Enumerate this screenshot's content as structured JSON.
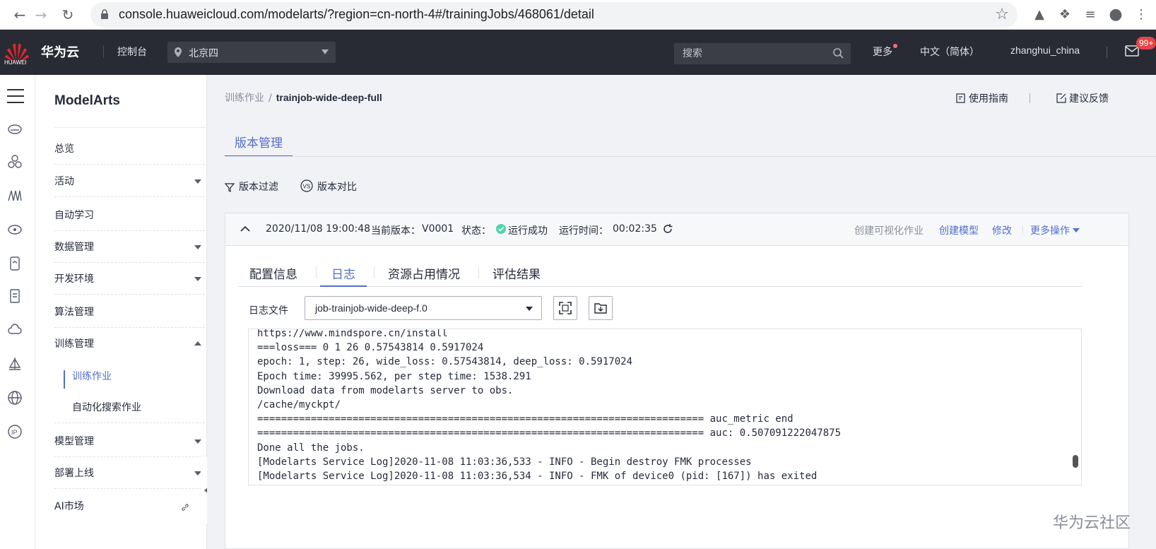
{
  "browser": {
    "url": "console.huaweicloud.com/modelarts/?region=cn-north-4#/trainingJobs/468061/detail",
    "icons": [
      "back-arrow-icon",
      "forward-arrow-icon",
      "reload-icon",
      "lock-icon",
      "star-icon",
      "drive-icon",
      "extensions-icon",
      "reading-list-icon",
      "account-icon",
      "more-vert-icon"
    ]
  },
  "topbar": {
    "logo_text": "HUAWEI",
    "brand": "华为云",
    "console": "控制台",
    "region": "北京四",
    "search_placeholder": "搜索",
    "more": "更多",
    "language": "中文（简体）",
    "username": "zhanghui_china",
    "mail_badge": "99+"
  },
  "sidebar": {
    "title": "ModelArts",
    "items": [
      {
        "label": "总览"
      },
      {
        "label": "活动"
      },
      {
        "label": "自动学习"
      },
      {
        "label": "数据管理"
      },
      {
        "label": "开发环境"
      },
      {
        "label": "算法管理"
      },
      {
        "label": "训练管理"
      },
      {
        "label": "模型管理"
      },
      {
        "label": "部署上线"
      },
      {
        "label": "AI市场"
      }
    ],
    "subitems": [
      {
        "label": "训练作业",
        "active": true
      },
      {
        "label": "自动化搜索作业",
        "active": false
      }
    ]
  },
  "breadcrumb": {
    "parent": "训练作业",
    "separator": "/",
    "current": "trainjob-wide-deep-full"
  },
  "header_links": {
    "guide": "使用指南",
    "feedback": "建议反馈"
  },
  "main_tab": "版本管理",
  "toolbar": {
    "filter": "版本过滤",
    "compare": "版本对比"
  },
  "version": {
    "datetime": "2020/11/08 19:00:48",
    "current_version_label": "当前版本：",
    "current_version": "V0001",
    "status_label": "状态：",
    "status": "运行成功",
    "runtime_label": "运行时间：",
    "runtime": "00:02:35",
    "actions": {
      "create_visual": "创建可视化作业",
      "create_model": "创建模型",
      "edit": "修改",
      "more": "更多操作"
    }
  },
  "inner_tabs": [
    "配置信息",
    "日志",
    "资源占用情况",
    "评估结果"
  ],
  "log": {
    "file_label": "日志文件",
    "file_selected": "job-trainjob-wide-deep-f.0",
    "lines": [
      "https://www.mindspore.cn/install",
      "===loss=== 0 1 26 0.57543814 0.5917024",
      "epoch: 1, step: 26, wide_loss: 0.57543814, deep_loss: 0.5917024",
      "Epoch time: 39995.562, per step time: 1538.291",
      "Download data from modelarts server to obs.",
      "/cache/myckpt/",
      "=========================================================================== auc_metric end",
      "=========================================================================== auc: 0.507091222047875",
      "Done all the jobs.",
      "[Modelarts Service Log]2020-11-08 11:03:36,533 - INFO - Begin destroy FMK processes",
      "[Modelarts Service Log]2020-11-08 11:03:36,534 - INFO - FMK of device0 (pid: [167]) has exited"
    ]
  },
  "watermark": "华为云社区",
  "colors": {
    "accent": "#526ecc",
    "topbar": "#282b33",
    "success": "#50d4ab",
    "badge": "#e64545"
  }
}
